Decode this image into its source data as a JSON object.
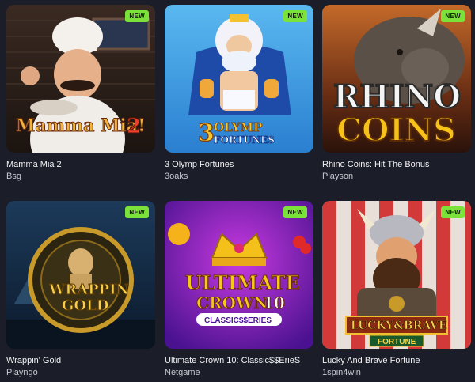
{
  "games": [
    {
      "title": "Mamma Mia 2",
      "provider": "Bsg",
      "badge": "NEW",
      "art_text": [
        "Mamma Mia!",
        "2"
      ]
    },
    {
      "title": "3 Olymp Fortunes",
      "provider": "3oaks",
      "badge": "NEW",
      "art_text": [
        "3",
        "OLYMP",
        "FORTUNES"
      ]
    },
    {
      "title": "Rhino Coins: Hit The Bonus",
      "provider": "Playson",
      "badge": "NEW",
      "art_text": [
        "RHINO",
        "COINS"
      ]
    },
    {
      "title": "Wrappin' Gold",
      "provider": "Playngo",
      "badge": "NEW",
      "art_text": [
        "WRAPPIN",
        "GOLD"
      ]
    },
    {
      "title": "Ultimate Crown 10: Classic$$ErieS",
      "provider": "Netgame",
      "badge": "NEW",
      "art_text": [
        "ULTIMATE",
        "CROWN",
        "10",
        "CLASSIC$$ERIES"
      ]
    },
    {
      "title": "Lucky And Brave Fortune",
      "provider": "1spin4win",
      "badge": "NEW",
      "art_text": [
        "LUCKY&BRAVE",
        "FORTUNE"
      ]
    }
  ]
}
